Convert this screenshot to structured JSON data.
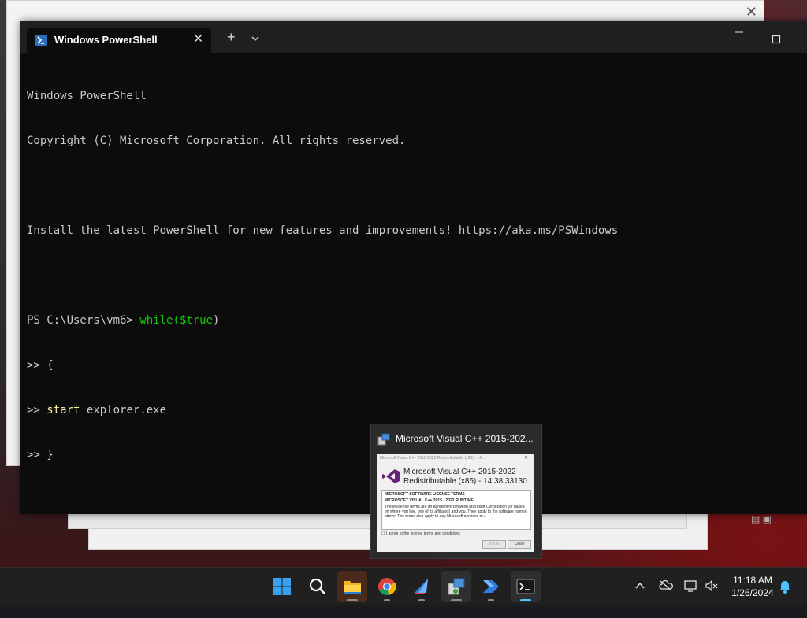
{
  "terminal": {
    "tab_title": "Windows PowerShell",
    "new_tab": "+",
    "dropdown": "⌄",
    "minimize": "—",
    "maximize": "☐",
    "close_tab": "✕",
    "lines": {
      "l1": "Windows PowerShell",
      "l2": "Copyright (C) Microsoft Corporation. All rights reserved.",
      "l4": "Install the latest PowerShell for new features and improvements! https://aka.ms/PSWindows",
      "prompt": "PS C:\\Users\\vm6> ",
      "cmd_while": "while",
      "cmd_cond": "($true",
      "cmd_paren": ")",
      "cont1": ">> {",
      "cont2_prefix": ">> ",
      "cont2_start": "start",
      "cont2_rest": " explorer.exe",
      "cont3": ">> }"
    }
  },
  "thumbnail": {
    "title": "Microsoft Visual C++ 2015-202...",
    "mini_title": "Microsoft Visual C++ 2015-2022 Redistributable (x86) - 14...",
    "product_line1": "Microsoft Visual C++ 2015-2022",
    "product_line2": "Redistributable (x86) - 14.38.33130",
    "license_heading1": "MICROSOFT SOFTWARE LICENSE TERMS",
    "license_heading2": "MICROSOFT VISUAL C++ 2015 - 2022 RUNTIME",
    "license_text": "These license terms are an agreement between Microsoft Corporation (or based on where you live, one of its affiliates) and you. They apply to the software named above. The terms also apply to any Microsoft services or...",
    "agree": "I agree to the license terms and conditions",
    "install_btn": "Install",
    "close_btn": "Close"
  },
  "taskbar": {
    "clock_time": "11:18 AM",
    "clock_date": "1/26/2024",
    "apps": [
      "start-icon",
      "search-icon",
      "file-explorer-icon",
      "chrome-icon",
      "sailboat-app-icon",
      "installer-icon",
      "power-automate-icon",
      "terminal-icon"
    ]
  },
  "background_window": {
    "close": "✕"
  }
}
